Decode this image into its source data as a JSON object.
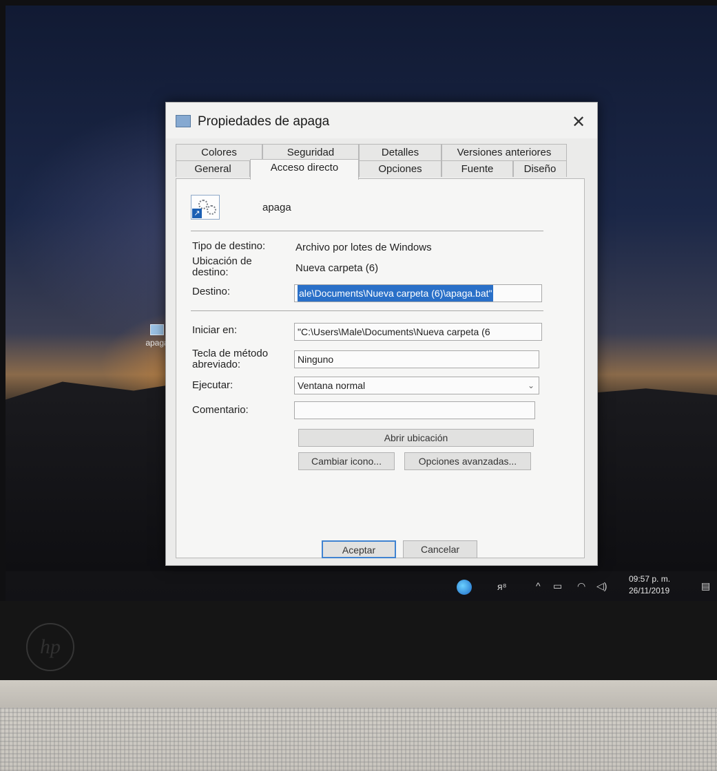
{
  "desktop": {
    "icon_label": "apaga"
  },
  "taskbar": {
    "time": "09:57 p. m.",
    "date": "26/11/2019"
  },
  "dialog": {
    "title": "Propiedades de apaga",
    "close_glyph": "✕",
    "tabs_row1": [
      "Colores",
      "Seguridad",
      "Detalles",
      "Versiones anteriores"
    ],
    "tabs_row2": [
      "General",
      "Acceso directo",
      "Opciones",
      "Fuente",
      "Diseño"
    ],
    "active_tab": "Acceso directo",
    "shortcut_name": "apaga",
    "labels": {
      "target_type": "Tipo de destino:",
      "target_location_line1": "Ubicación de",
      "target_location_line2": "destino:",
      "target": "Destino:",
      "start_in": "Iniciar en:",
      "shortcut_key_line1": "Tecla de método",
      "shortcut_key_line2": "abreviado:",
      "run": "Ejecutar:",
      "comment": "Comentario:"
    },
    "values": {
      "target_type": "Archivo por lotes de Windows",
      "target_location": "Nueva carpeta (6)",
      "target": "ale\\Documents\\Nueva carpeta (6)\\apaga.bat\"",
      "start_in": "\"C:\\Users\\Male\\Documents\\Nueva carpeta (6",
      "shortcut_key": "Ninguno",
      "run": "Ventana normal",
      "comment": ""
    },
    "buttons": {
      "open_location": "Abrir ubicación",
      "change_icon": "Cambiar icono...",
      "advanced": "Opciones avanzadas...",
      "ok": "Aceptar",
      "cancel": "Cancelar"
    }
  }
}
